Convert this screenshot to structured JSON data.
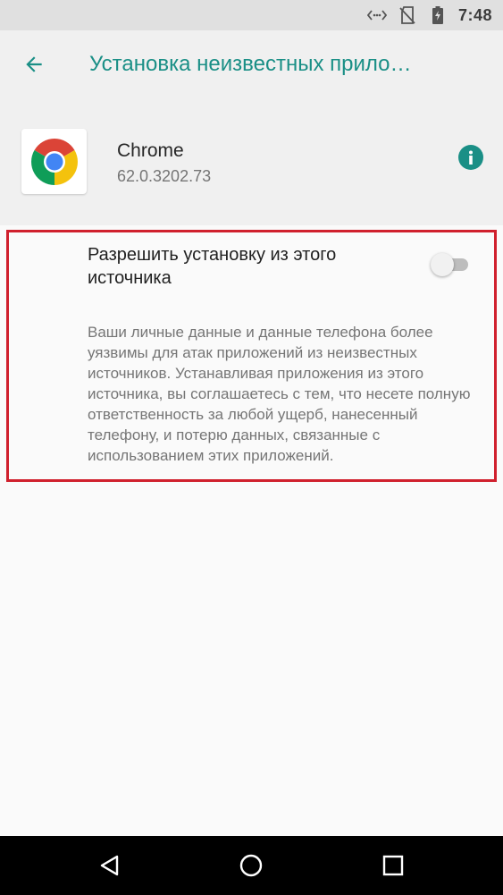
{
  "status_bar": {
    "time": "7:48",
    "icons": [
      "data-transfer-icon",
      "no-sim-icon",
      "battery-charging-icon"
    ]
  },
  "app_bar": {
    "title": "Установка неизвестных прило…",
    "back_icon": "arrow-back-icon"
  },
  "app": {
    "name": "Chrome",
    "version": "62.0.3202.73",
    "icon": "chrome-logo-icon",
    "info_icon": "info-icon"
  },
  "setting": {
    "title": "Разрешить установку из этого источника",
    "enabled": false,
    "description": "Ваши личные данные и данные телефона более уязвимы для атак приложений из неизвестных источников. Устанавливая приложения из этого источника, вы соглашаетесь с тем, что несете полную ответственность за любой ущерб, нанесенный телефону, и потерю данных, связанные с использованием этих приложений."
  },
  "nav_bar": {
    "icons": [
      "back-triangle-icon",
      "home-circle-icon",
      "recents-square-icon"
    ]
  },
  "colors": {
    "accent": "#1a8f86",
    "highlight": "#d0202d",
    "background": "#fafafa",
    "header_background": "#f0f0f0"
  }
}
